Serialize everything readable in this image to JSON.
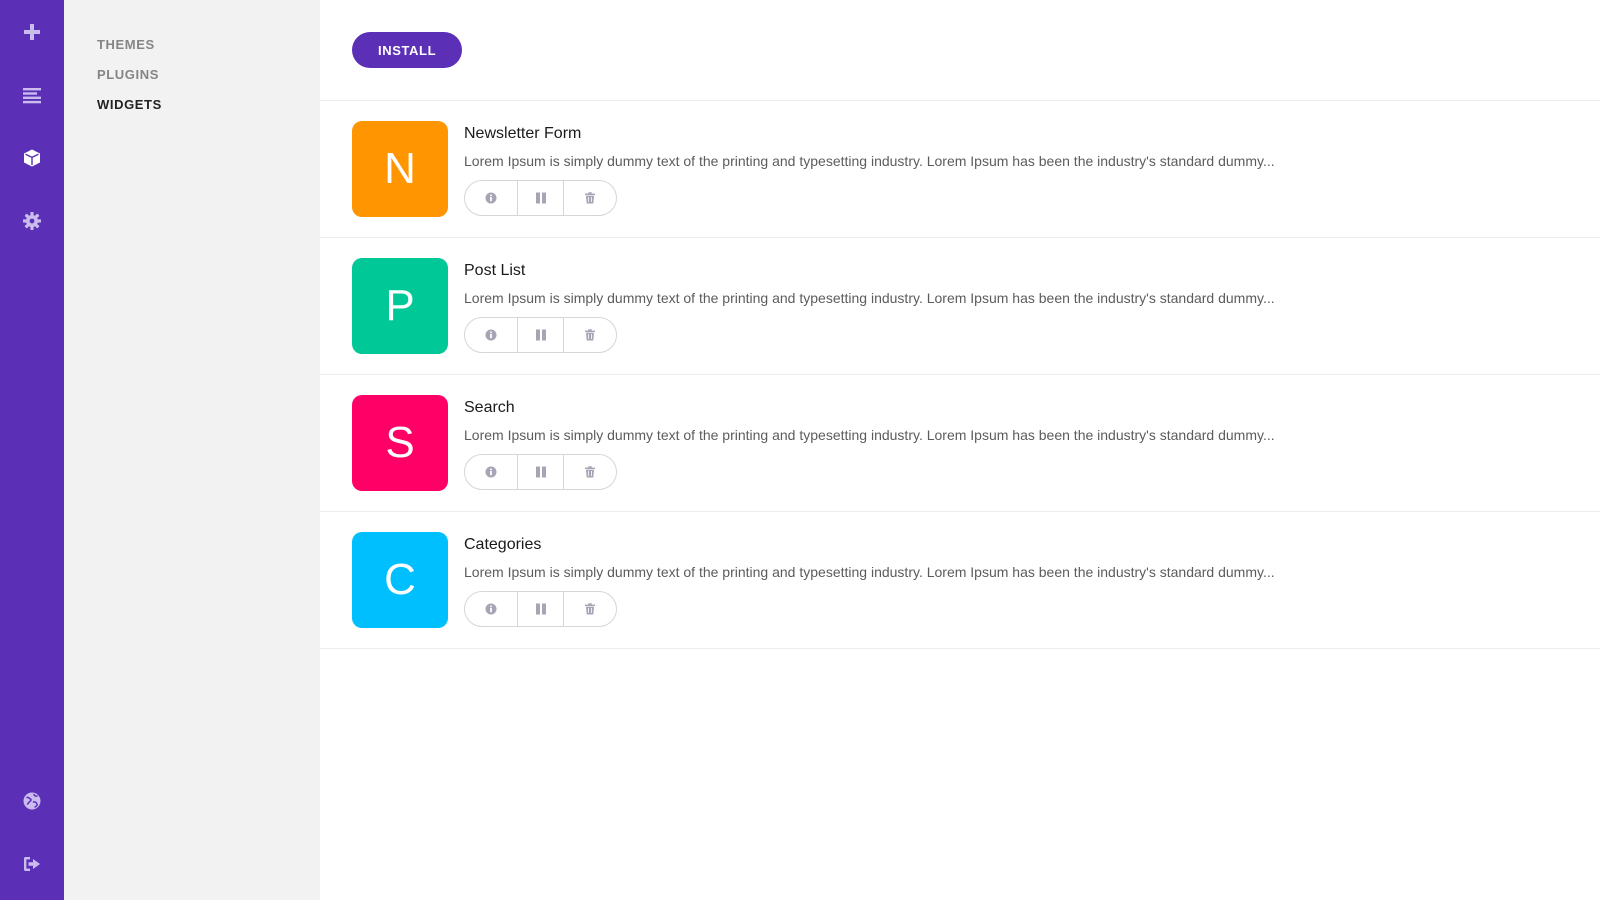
{
  "rail": {
    "top_icons": [
      {
        "name": "plus-icon",
        "active": false
      },
      {
        "name": "list-lines-icon",
        "active": false
      },
      {
        "name": "cube-icon",
        "active": true
      },
      {
        "name": "gear-icon",
        "active": false
      }
    ],
    "bottom_icons": [
      {
        "name": "globe-icon",
        "active": false
      },
      {
        "name": "sign-out-icon",
        "active": false
      }
    ]
  },
  "subnav": {
    "items": [
      {
        "label": "THEMES",
        "active": false
      },
      {
        "label": "PLUGINS",
        "active": false
      },
      {
        "label": "WIDGETS",
        "active": true
      }
    ]
  },
  "toolbar": {
    "install_label": "INSTALL"
  },
  "widgets": [
    {
      "letter": "N",
      "title": "Newsletter Form",
      "color": "#ff9500",
      "description": "Lorem Ipsum is simply dummy text of the printing and typesetting industry. Lorem Ipsum has been the industry's standard dummy..."
    },
    {
      "letter": "P",
      "title": "Post List",
      "color": "#00c896",
      "description": "Lorem Ipsum is simply dummy text of the printing and typesetting industry. Lorem Ipsum has been the industry's standard dummy..."
    },
    {
      "letter": "S",
      "title": "Search",
      "color": "#ff0066",
      "description": "Lorem Ipsum is simply dummy text of the printing and typesetting industry. Lorem Ipsum has been the industry's standard dummy..."
    },
    {
      "letter": "C",
      "title": "Categories",
      "color": "#00bfff",
      "description": "Lorem Ipsum is simply dummy text of the printing and typesetting industry. Lorem Ipsum has been the industry's standard dummy..."
    }
  ],
  "widget_actions": [
    "info-icon",
    "pause-icon",
    "trash-icon"
  ],
  "colors": {
    "brand": "#5b2fb6",
    "sidebar_bg": "#f2f2f2"
  }
}
